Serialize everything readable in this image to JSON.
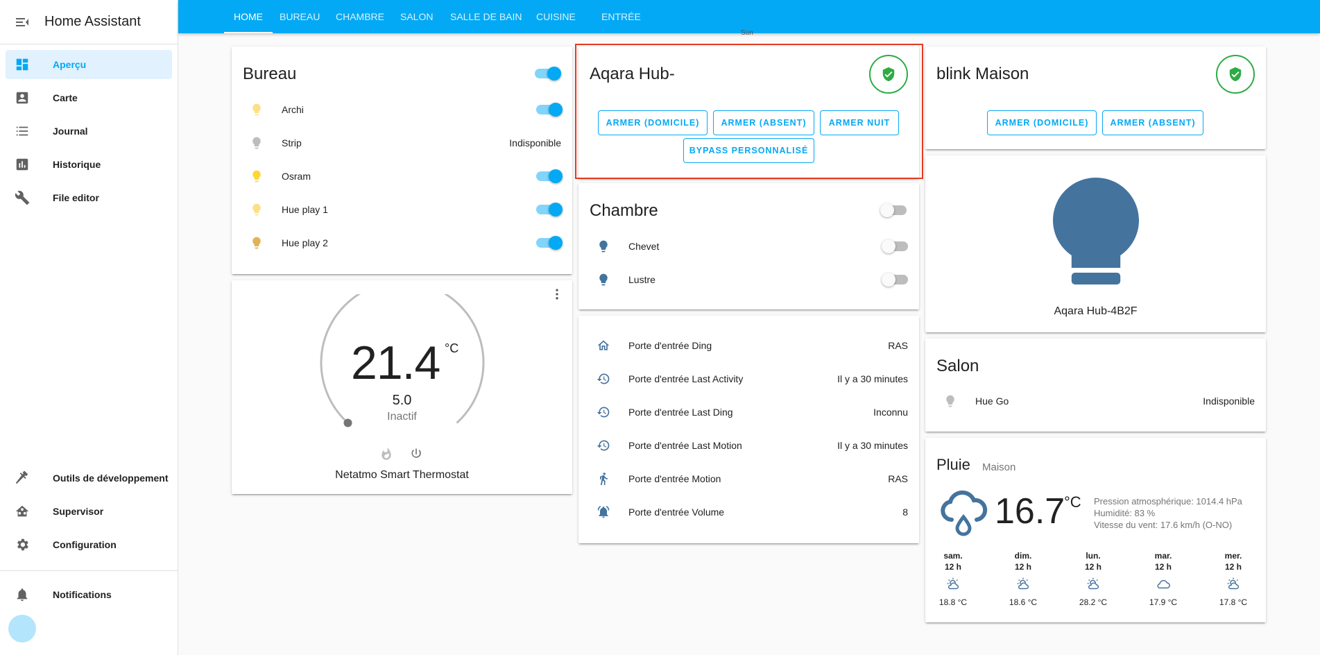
{
  "sidebar": {
    "title": "Home Assistant",
    "items": [
      {
        "label": "Aperçu"
      },
      {
        "label": "Carte"
      },
      {
        "label": "Journal"
      },
      {
        "label": "Historique"
      },
      {
        "label": "File editor"
      },
      {
        "label": "Outils de développement"
      },
      {
        "label": "Supervisor"
      },
      {
        "label": "Configuration"
      },
      {
        "label": "Notifications"
      }
    ]
  },
  "header": {
    "tabs": [
      "HOME",
      "BUREAU",
      "CHAMBRE",
      "SALON",
      "SALLE DE BAIN",
      "CUISINE",
      "ENTRÉE"
    ],
    "sun_label": "Sun"
  },
  "bureau": {
    "title": "Bureau",
    "rows": [
      {
        "name": "Archi",
        "state": "on"
      },
      {
        "name": "Strip",
        "state": "Indisponible"
      },
      {
        "name": "Osram",
        "state": "on"
      },
      {
        "name": "Hue play 1",
        "state": "on"
      },
      {
        "name": "Hue play 2",
        "state": "on"
      }
    ]
  },
  "thermostat": {
    "temperature": "21.4",
    "unit": "°C",
    "target": "5.0",
    "status": "Inactif",
    "name": "Netatmo Smart Thermostat"
  },
  "aqara": {
    "title": "Aqara Hub-",
    "buttons": [
      "ARMER (DOMICILE)",
      "ARMER (ABSENT)",
      "ARMER NUIT",
      "BYPASS PERSONNALISÉ"
    ]
  },
  "chambre": {
    "title": "Chambre",
    "rows": [
      {
        "name": "Chevet"
      },
      {
        "name": "Lustre"
      }
    ]
  },
  "entree": {
    "rows": [
      {
        "name": "Porte d'entrée Ding",
        "value": "RAS",
        "icon": "home-outline-icon"
      },
      {
        "name": "Porte d'entrée Last Activity",
        "value": "Il y a 30 minutes",
        "icon": "history-icon"
      },
      {
        "name": "Porte d'entrée Last Ding",
        "value": "Inconnu",
        "icon": "history-icon"
      },
      {
        "name": "Porte d'entrée Last Motion",
        "value": "Il y a 30 minutes",
        "icon": "history-icon"
      },
      {
        "name": "Porte d'entrée Motion",
        "value": "RAS",
        "icon": "walk-icon"
      },
      {
        "name": "Porte d'entrée Volume",
        "value": "8",
        "icon": "bell-ring-icon"
      }
    ]
  },
  "blink": {
    "title": "blink Maison",
    "buttons": [
      "ARMER (DOMICILE)",
      "ARMER (ABSENT)"
    ]
  },
  "aqara_light": {
    "name": "Aqara Hub-4B2F"
  },
  "salon": {
    "title": "Salon",
    "rows": [
      {
        "name": "Hue Go",
        "state": "Indisponible"
      }
    ]
  },
  "weather": {
    "condition": "Pluie",
    "location": "Maison",
    "temperature": "16.7",
    "unit": "°C",
    "pressure": "Pression atmosphérique: 1014.4 hPa",
    "humidity": "Humidité: 83 %",
    "wind": "Vitesse du vent: 17.6 km/h (O-NO)",
    "forecast": [
      {
        "day": "sam.",
        "hour": "12 h",
        "temp": "18.8 °C",
        "icon": "partly-cloudy-icon"
      },
      {
        "day": "dim.",
        "hour": "12 h",
        "temp": "18.6 °C",
        "icon": "partly-cloudy-icon"
      },
      {
        "day": "lun.",
        "hour": "12 h",
        "temp": "28.2 °C",
        "icon": "partly-cloudy-icon"
      },
      {
        "day": "mar.",
        "hour": "12 h",
        "temp": "17.9 °C",
        "icon": "cloudy-icon"
      },
      {
        "day": "mer.",
        "hour": "12 h",
        "temp": "17.8 °C",
        "icon": "partly-cloudy-icon"
      }
    ]
  },
  "colors": {
    "primary": "#03a9f4",
    "bulb_yellow": "#fdd835",
    "bulb_light_yellow": "#fcdf88",
    "bulb_amber": "#e1b355",
    "bulb_grey": "#bdbdbd",
    "state_icon_blue": "#44739e",
    "alarm_green": "#2eab45",
    "highlight_red": "#e53a20"
  }
}
